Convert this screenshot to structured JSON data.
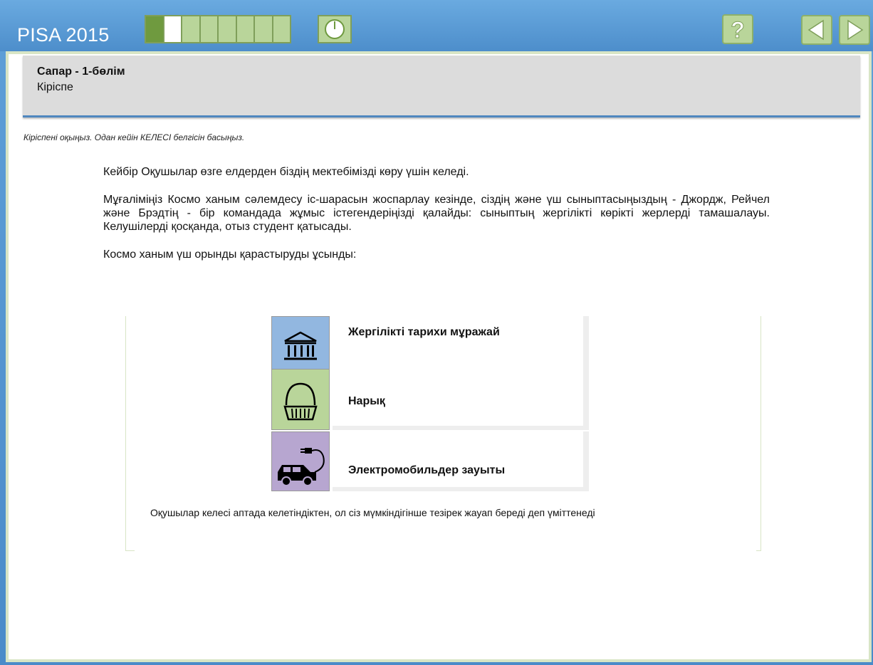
{
  "app": {
    "title": "PISA 2015"
  },
  "header": {
    "unit_title": "Сапар - 1-бөлім",
    "unit_subtitle": "Кіріспе"
  },
  "instruction": "Кіріспені оқыңыз. Одан кейін КЕЛЕСІ белгісін басыңыз.",
  "content": {
    "p1": "Кейбір Оқушылар өзге елдерден біздің мектебімізді көру үшін келеді.",
    "p2": "Мұғаліміңіз Космо ханым сәлемдесу іс-шарасын жоспарлау кезінде, сіздің және үш сыныптасыңыздың - Джордж, Рейчел және Брэдтің - бір командада жұмыс істегендеріңізді қалайды: сыныптың жергілікті көрікті жерлерді тамашалауы. Келушілерді қосқанда, отыз студент қатысады.",
    "p3": "Космо ханым үш орынды қарастыруды ұсынды:"
  },
  "places": [
    {
      "label": "Жергілікті тарихи мұражай",
      "icon": "museum-icon",
      "color": "#92b7e0"
    },
    {
      "label": "Нарық",
      "icon": "basket-icon",
      "color": "#b9d59a"
    },
    {
      "label": "Электромобильдер зауыты",
      "icon": "electric-car-icon",
      "color": "#b7a6d0"
    }
  ],
  "footer_note": "Оқушылар келесі аптада келетіндіктен, ол сіз мүмкіндігінше тезірек жауап береді деп үміттенеді",
  "progress": {
    "total": 8,
    "completed": 1,
    "current": 2
  },
  "colors": {
    "brand_blue": "#4d8ecb",
    "accent_green": "#b9d59a",
    "dark_green": "#6f9a3f"
  }
}
